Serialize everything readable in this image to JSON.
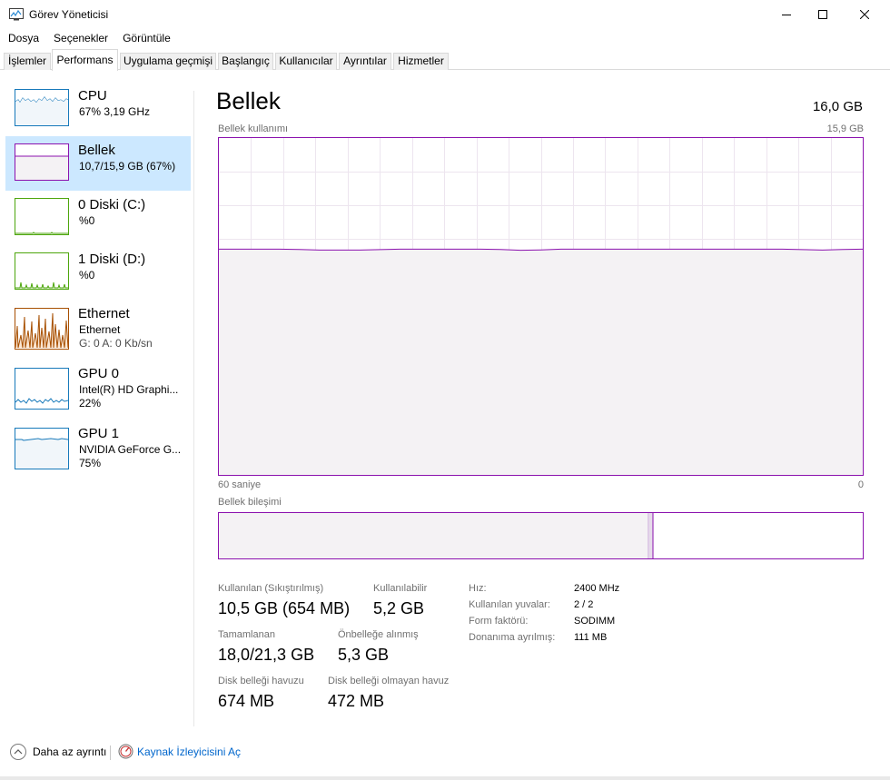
{
  "window": {
    "title": "Görev Yöneticisi"
  },
  "menu": {
    "items": [
      "Dosya",
      "Seçenekler",
      "Görüntüle"
    ]
  },
  "tabs": {
    "items": [
      "İşlemler",
      "Performans",
      "Uygulama geçmişi",
      "Başlangıç",
      "Kullanıcılar",
      "Ayrıntılar",
      "Hizmetler"
    ],
    "active": "Performans"
  },
  "resources": {
    "cpu": {
      "name": "CPU",
      "sub": "67%  3,19 GHz"
    },
    "memory": {
      "name": "Bellek",
      "sub": "10,7/15,9 GB (67%)"
    },
    "disk0": {
      "name": "0 Diski (C:)",
      "sub": "%0"
    },
    "disk1": {
      "name": "1 Diski (D:)",
      "sub": "%0"
    },
    "ethernet": {
      "name": "Ethernet",
      "sub1": "Ethernet",
      "sub2": "G: 0  A: 0 Kb/sn"
    },
    "gpu0": {
      "name": "GPU 0",
      "sub1": "Intel(R) HD Graphi...",
      "sub2": "22%"
    },
    "gpu1": {
      "name": "GPU 1",
      "sub1": "NVIDIA GeForce G...",
      "sub2": "75%"
    }
  },
  "main": {
    "title": "Bellek",
    "total": "16,0 GB",
    "usage_label": "Bellek kullanımı",
    "usage_max": "15,9 GB",
    "axis_left": "60 saniye",
    "axis_right": "0",
    "composition_label": "Bellek bileşimi",
    "usage_fraction": 0.67
  },
  "stats": {
    "in_use_label": "Kullanılan (Sıkıştırılmış)",
    "in_use_value": "10,5 GB (654 MB)",
    "available_label": "Kullanılabilir",
    "available_value": "5,2 GB",
    "committed_label": "Tamamlanan",
    "committed_value": "18,0/21,3 GB",
    "cached_label": "Önbelleğe alınmış",
    "cached_value": "5,3 GB",
    "paged_label": "Disk belleği havuzu",
    "paged_value": "674 MB",
    "nonpaged_label": "Disk belleği olmayan havuz",
    "nonpaged_value": "472 MB"
  },
  "specs": [
    {
      "label": "Hız:",
      "value": "2400 MHz"
    },
    {
      "label": "Kullanılan yuvalar:",
      "value": "2 / 2"
    },
    {
      "label": "Form faktörü:",
      "value": "SODIMM"
    },
    {
      "label": "Donanıma ayrılmış:",
      "value": "111 MB"
    }
  ],
  "footer": {
    "fewer_details": "Daha az ayrıntı",
    "resource_monitor": "Kaynak İzleyicisini Aç"
  },
  "colors": {
    "memory_accent": "#8b12ae",
    "memory_fill": "#f4f2f4",
    "cpu_accent": "#1779ba",
    "disk_accent": "#4da60c",
    "ethernet_accent": "#a74f01",
    "selected_bg": "#cce8ff"
  }
}
